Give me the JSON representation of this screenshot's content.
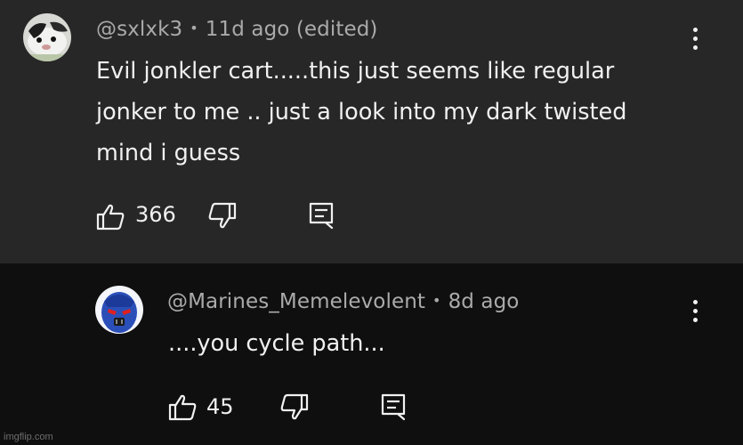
{
  "comment": {
    "handle": "@sxlxk3",
    "time": "11d ago (edited)",
    "lines": [
      "Evil jonkler cart.....this just seems like regular",
      "jonker to me .. just a look into my dark twisted",
      "mind i guess"
    ],
    "likes": "366"
  },
  "reply": {
    "handle": "@Marines_Memelevolent",
    "time": "8d ago",
    "text": "....you cycle path...",
    "likes": "45"
  },
  "separator": "•",
  "watermark": "imgflip.com",
  "colors": {
    "top_background": "#272727",
    "bottom_background": "#0f0f0f",
    "meta_text": "#aaaaaa",
    "body_text": "#f1f1f1"
  },
  "icons": [
    "like-icon",
    "dislike-icon",
    "reply-icon",
    "more-options-icon"
  ]
}
